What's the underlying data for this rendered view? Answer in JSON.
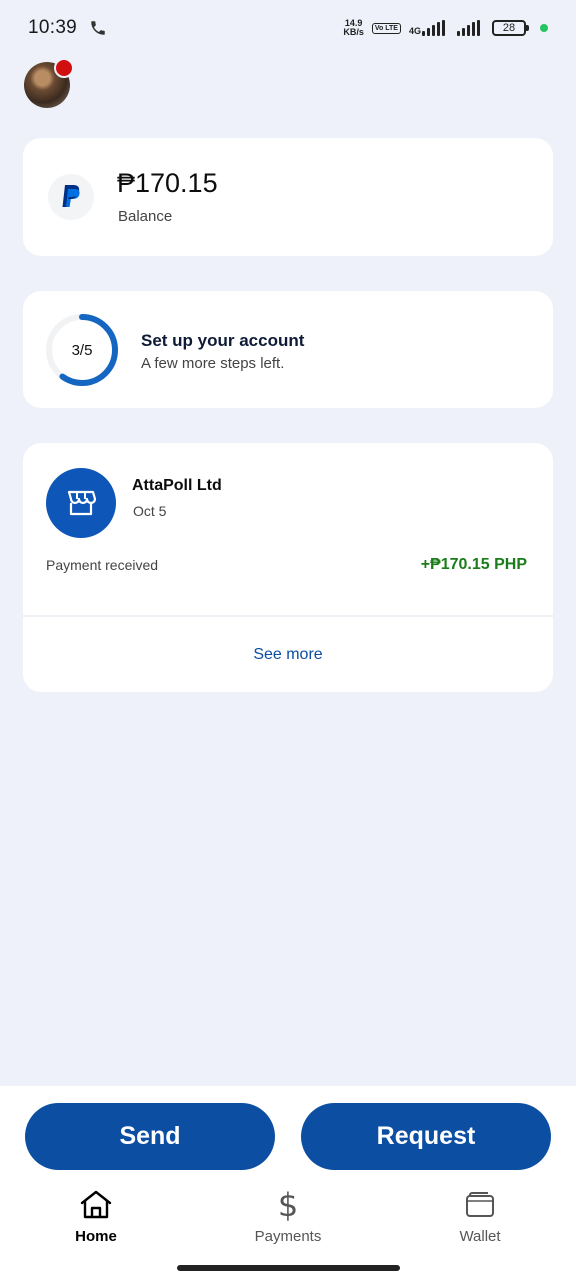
{
  "status_bar": {
    "time": "10:39",
    "net_speed_value": "14.9",
    "net_speed_unit": "KB/s",
    "volte": "Vo LTE",
    "network": "4G",
    "battery": "28"
  },
  "balance": {
    "amount": "₱170.15",
    "label": "Balance"
  },
  "setup": {
    "progress": "3/5",
    "progress_fraction": 0.6,
    "title": "Set up your account",
    "subtitle": "A few more steps left."
  },
  "activity": {
    "merchant": "AttaPoll Ltd",
    "date": "Oct 5",
    "status": "Payment received",
    "amount": "+₱170.15 PHP",
    "see_more": "See more"
  },
  "actions": {
    "send": "Send",
    "request": "Request"
  },
  "nav": {
    "home": "Home",
    "payments": "Payments",
    "wallet": "Wallet"
  },
  "icons": {
    "phone": "phone-icon",
    "merchant": "store-icon",
    "home": "home-icon",
    "payments": "dollar-icon",
    "wallet": "wallet-icon"
  },
  "colors": {
    "brand_blue": "#0b4ea2",
    "positive_green": "#1a7d1a",
    "notification_red": "#d20f0f",
    "background": "#eef1f9"
  }
}
